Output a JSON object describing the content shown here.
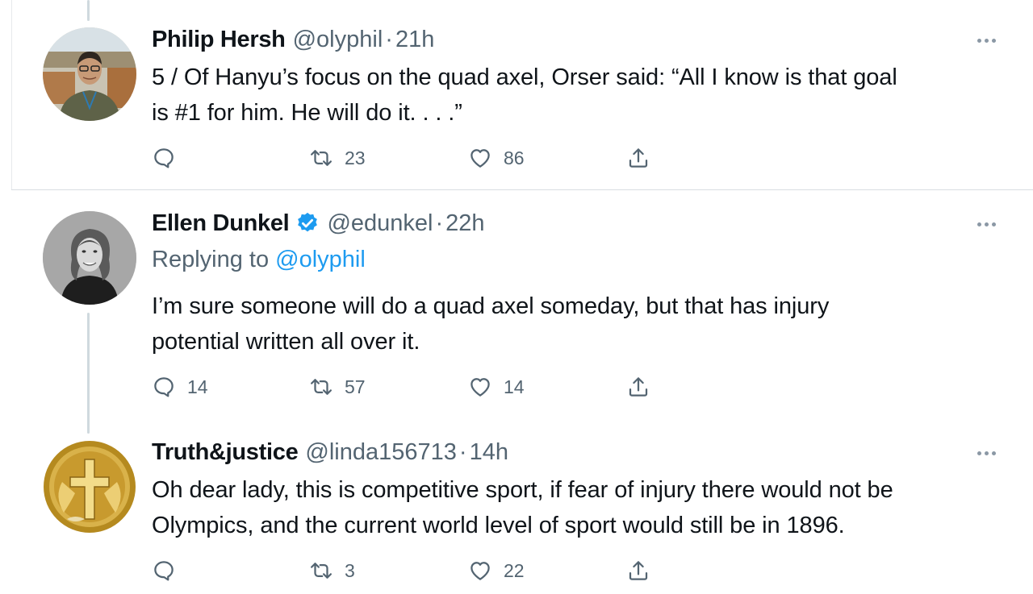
{
  "tweets": [
    {
      "name": "Philip Hersh",
      "handle": "@olyphil",
      "dot": "·",
      "time": "21h",
      "verified": false,
      "text_lines": [
        "5 / Of Hanyu’s focus on the quad axel, Orser said:  “All I know is that goal",
        "is #1 for him.  He will do it. . . .”"
      ],
      "reply_count": "",
      "retweet_count": "23",
      "like_count": "86"
    },
    {
      "name": "Ellen Dunkel",
      "handle": "@edunkel",
      "dot": "·",
      "time": "22h",
      "verified": true,
      "replying_prefix": "Replying to",
      "replying_handle": "@olyphil",
      "text_lines": [
        "I’m sure someone will do a quad axel someday, but that has injury",
        "potential written all over it."
      ],
      "reply_count": "14",
      "retweet_count": "57",
      "like_count": "14"
    },
    {
      "name": "Truth&justice",
      "handle": "@linda156713",
      "dot": "·",
      "time": "14h",
      "verified": false,
      "text_lines": [
        "Oh dear lady, this is competitive sport, if fear of injury there would not be",
        "Olympics, and the current world level of sport would still be in 1896."
      ],
      "reply_count": "",
      "retweet_count": "3",
      "like_count": "22"
    }
  ],
  "icons": {
    "reply": "reply-icon",
    "retweet": "retweet-icon",
    "like": "heart-icon",
    "share": "share-icon",
    "more": "more-icon",
    "verified": "verified-badge-icon"
  },
  "colors": {
    "text": "#0f1419",
    "secondary": "#536471",
    "link": "#1d9bf0",
    "verified": "#1d9bf0",
    "icon": "#536471",
    "divider": "#d9dde1"
  }
}
